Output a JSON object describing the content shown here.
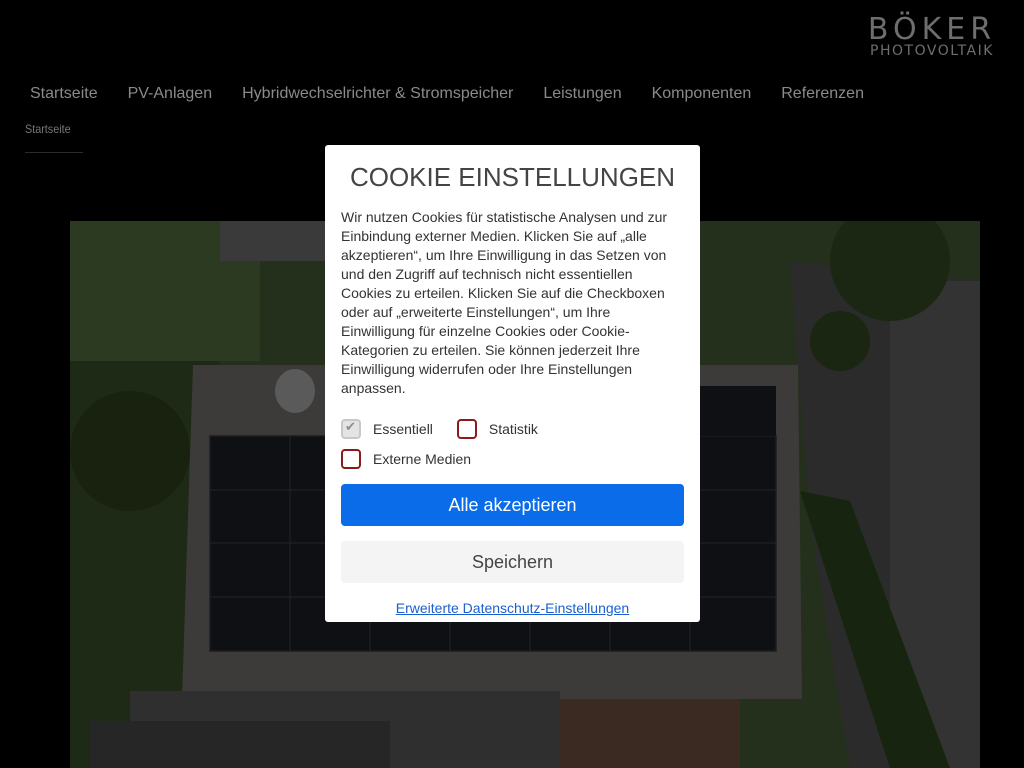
{
  "logo": {
    "main": "BÖKER",
    "sub": "PHOTOVOLTAIK"
  },
  "nav": {
    "items": [
      {
        "label": "Startseite"
      },
      {
        "label": "PV-Anlagen"
      },
      {
        "label": "Hybridwechselrichter & Stromspeicher"
      },
      {
        "label": "Leistungen"
      },
      {
        "label": "Komponenten"
      },
      {
        "label": "Referenzen"
      }
    ]
  },
  "breadcrumb": {
    "label": "Startseite"
  },
  "cookie": {
    "title": "COOKIE EINSTELLUNGEN",
    "text": "Wir nutzen Cookies für statistische Analysen und zur Einbindung externer Medien. Klicken Sie auf „alle akzeptieren“, um Ihre Einwilligung in das Setzen von und den Zugriff auf technisch nicht essentiellen Cookies zu erteilen. Klicken Sie auf die Checkboxen oder auf „erweiterte Einstellungen“, um Ihre Einwilligung für einzelne Cookies oder Cookie-Kategorien zu erteilen. Sie können jederzeit Ihre Einwilligung widerrufen oder Ihre Einstellungen anpassen.",
    "checkboxes": [
      {
        "label": "Essentiell",
        "checked": true,
        "disabled": true
      },
      {
        "label": "Statistik",
        "checked": false,
        "disabled": false
      },
      {
        "label": "Externe Medien",
        "checked": false,
        "disabled": false
      }
    ],
    "accept_label": "Alle akzeptieren",
    "save_label": "Speichern",
    "advanced_link": "Erweiterte Datenschutz-Einstellungen"
  },
  "colors": {
    "background": "#000000",
    "accept_button": "#0a6ce8",
    "checkbox_border": "#8b1a1a",
    "link": "#1a5fd0"
  }
}
